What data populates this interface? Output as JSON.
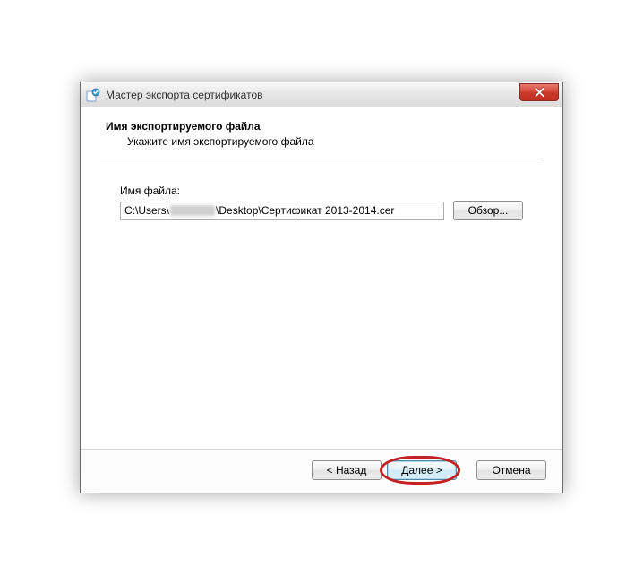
{
  "window": {
    "title": "Мастер экспорта сертификатов"
  },
  "header": {
    "title": "Имя экспортируемого файла",
    "subtitle": "Укажите имя экспортируемого файла"
  },
  "form": {
    "file_label": "Имя файла:",
    "file_path_prefix": "C:\\Users\\",
    "file_path_suffix": "\\Desktop\\Сертификат 2013-2014.cer",
    "browse_label": "Обзор..."
  },
  "footer": {
    "back_label": "< Назад",
    "next_label": "Далее >",
    "cancel_label": "Отмена"
  }
}
